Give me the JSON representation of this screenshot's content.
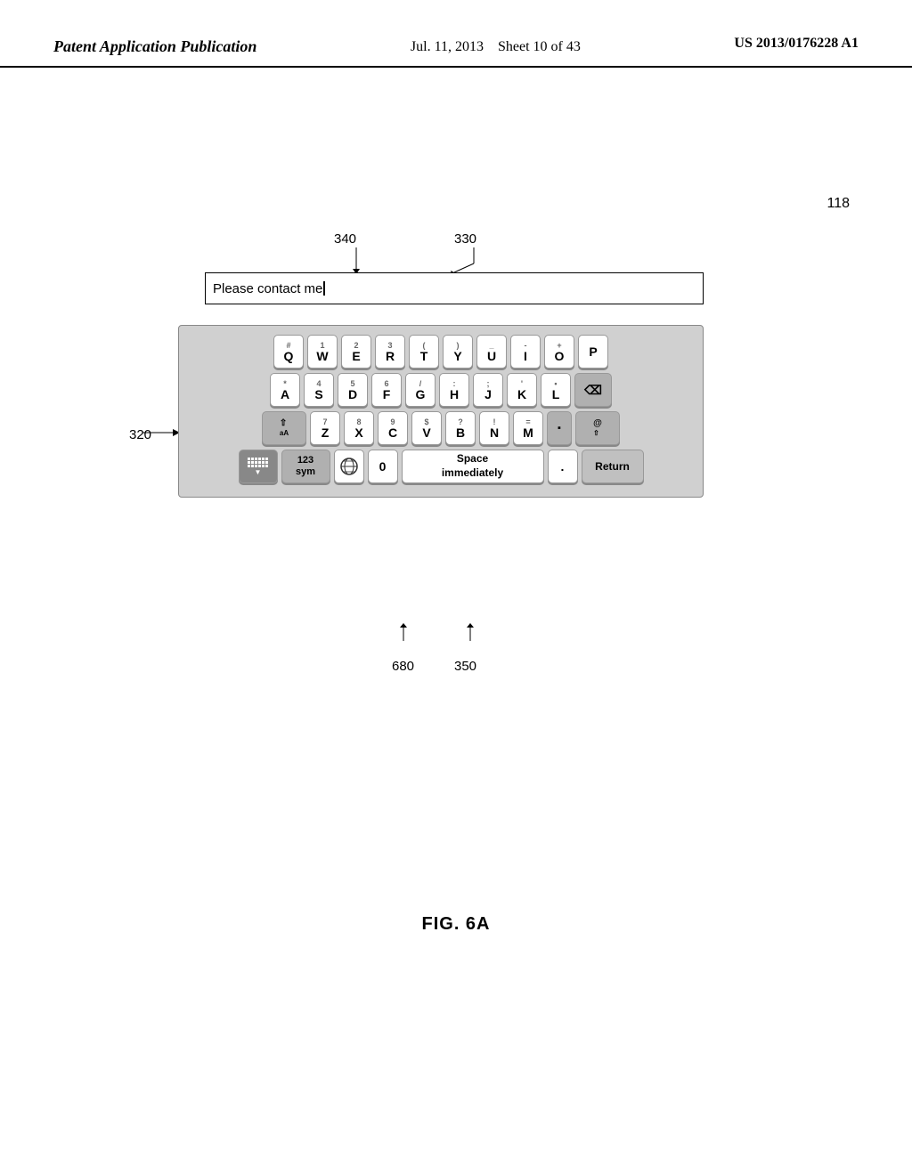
{
  "header": {
    "left": "Patent Application Publication",
    "center_date": "Jul. 11, 2013",
    "center_sheet": "Sheet 10 of 43",
    "right": "US 2013/0176228 A1"
  },
  "ref_numbers": {
    "r118": "118",
    "r340": "340",
    "r330": "330",
    "r320": "320",
    "r680": "680",
    "r350": "350"
  },
  "text_input": {
    "value": "Please contact me",
    "cursor": "▎"
  },
  "keyboard": {
    "row1": [
      {
        "main": "Q",
        "sub": "#"
      },
      {
        "main": "W",
        "sub": "1"
      },
      {
        "main": "E",
        "sub": "2"
      },
      {
        "main": "R",
        "sub": "3"
      },
      {
        "main": "T",
        "sub": "("
      },
      {
        "main": "Y",
        "sub": ")"
      },
      {
        "main": "U",
        "sub": "_"
      },
      {
        "main": "I",
        "sub": "-"
      },
      {
        "main": "O",
        "sub": "+"
      },
      {
        "main": "P",
        "sub": ""
      }
    ],
    "row2": [
      {
        "main": "A",
        "sub": "*"
      },
      {
        "main": "S",
        "sub": "4"
      },
      {
        "main": "D",
        "sub": "5"
      },
      {
        "main": "F",
        "sub": "6"
      },
      {
        "main": "G",
        "sub": "/"
      },
      {
        "main": "H",
        "sub": ":"
      },
      {
        "main": "J",
        "sub": ";"
      },
      {
        "main": "K",
        "sub": "'"
      },
      {
        "main": "L",
        "sub": "•"
      }
    ],
    "row3": [
      {
        "main": "Z",
        "sub": "7"
      },
      {
        "main": "X",
        "sub": "8"
      },
      {
        "main": "C",
        "sub": "9"
      },
      {
        "main": "V",
        "sub": "$"
      },
      {
        "main": "B",
        "sub": "?"
      },
      {
        "main": "N",
        "sub": "!"
      },
      {
        "main": "M",
        "sub": "="
      }
    ],
    "row4": {
      "sym_label": "123\nsym",
      "globe_label": "🌐",
      "space_label": "Space\nimmediately",
      "period_label": ".",
      "return_label": "Return"
    }
  },
  "figure_label": "FIG. 6A"
}
